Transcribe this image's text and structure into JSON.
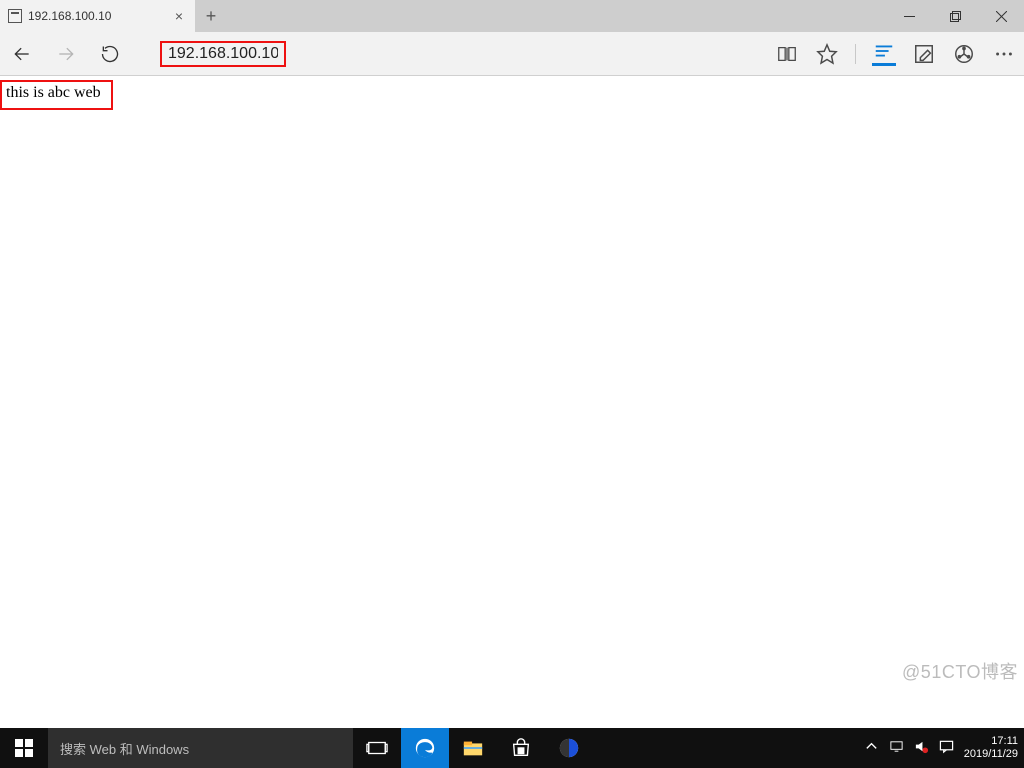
{
  "browser": {
    "tab_title": "192.168.100.10",
    "address": "192.168.100.10"
  },
  "page": {
    "body_text": "this is abc web"
  },
  "taskbar": {
    "search_placeholder": "搜索 Web 和 Windows",
    "clock_time": "17:11",
    "clock_date": "2019/11/29"
  },
  "watermark": "@51CTO博客",
  "colors": {
    "highlight_red": "#e11",
    "edge_blue": "#0a7cd8"
  }
}
